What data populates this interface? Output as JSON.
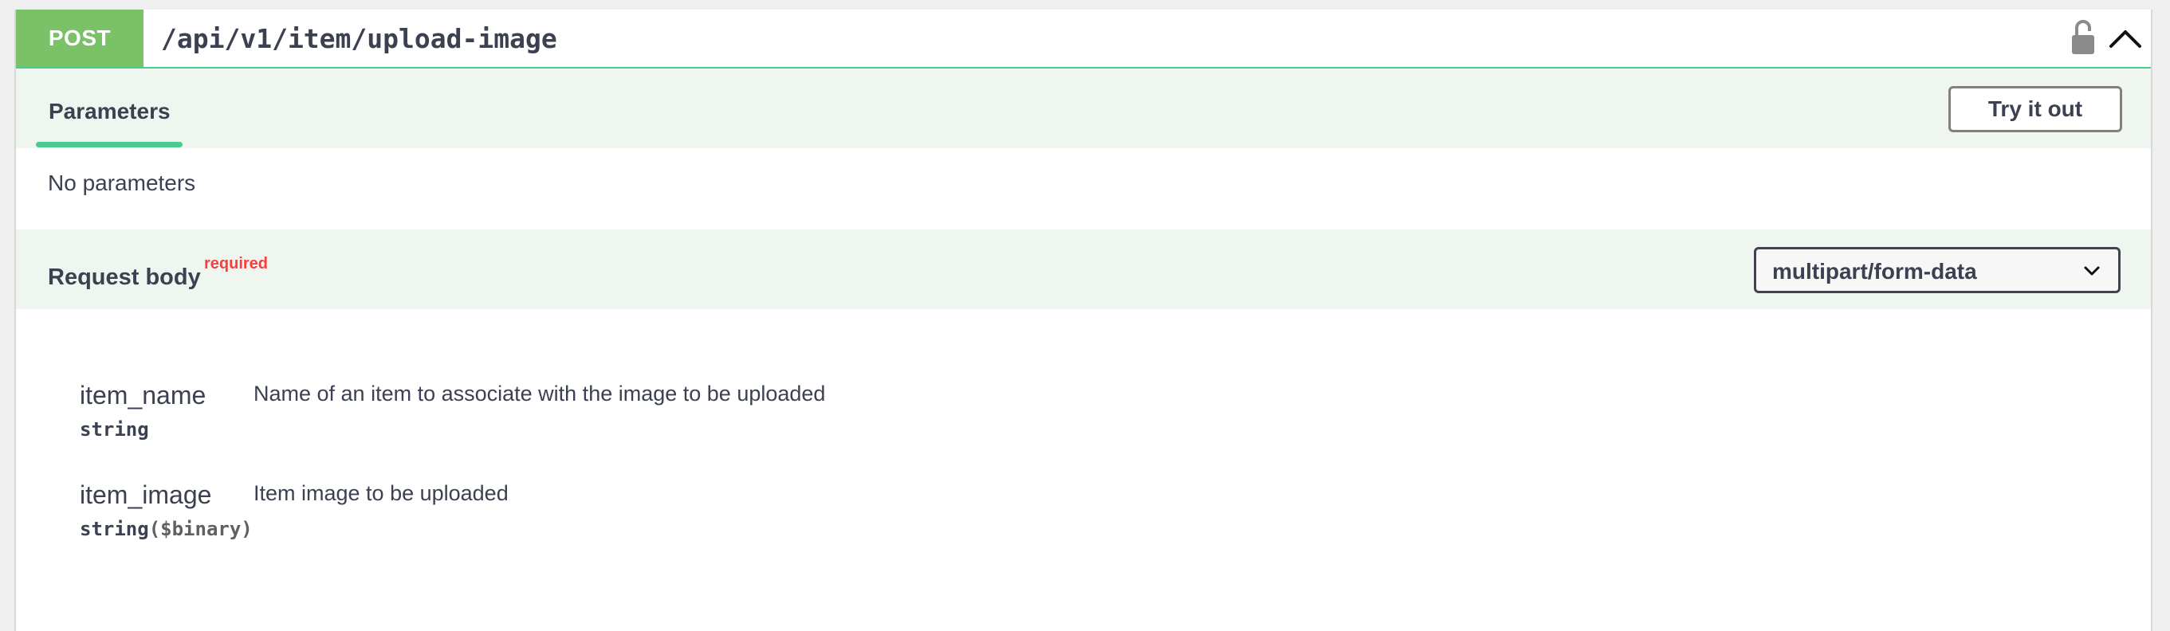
{
  "operation": {
    "method": "POST",
    "path": "/api/v1/item/upload-image"
  },
  "parameters": {
    "tab_label": "Parameters",
    "try_it_out_label": "Try it out",
    "empty_text": "No parameters"
  },
  "request_body": {
    "title": "Request body",
    "required_label": "required",
    "content_type": "multipart/form-data",
    "properties": [
      {
        "name": "item_name",
        "type": "string",
        "format": "",
        "description": "Name of an item to associate with the image to be uploaded"
      },
      {
        "name": "item_image",
        "type": "string",
        "format": "($binary)",
        "description": "Item image to be uploaded"
      }
    ]
  },
  "icons": {
    "lock": "unlocked-padlock-icon",
    "collapse": "chevron-up-icon",
    "select_arrow": "chevron-down-icon"
  },
  "colors": {
    "method_post": "#7ac168",
    "accent": "#49cc90",
    "section_bg": "#eff6ef",
    "required": "#f93e3e"
  }
}
